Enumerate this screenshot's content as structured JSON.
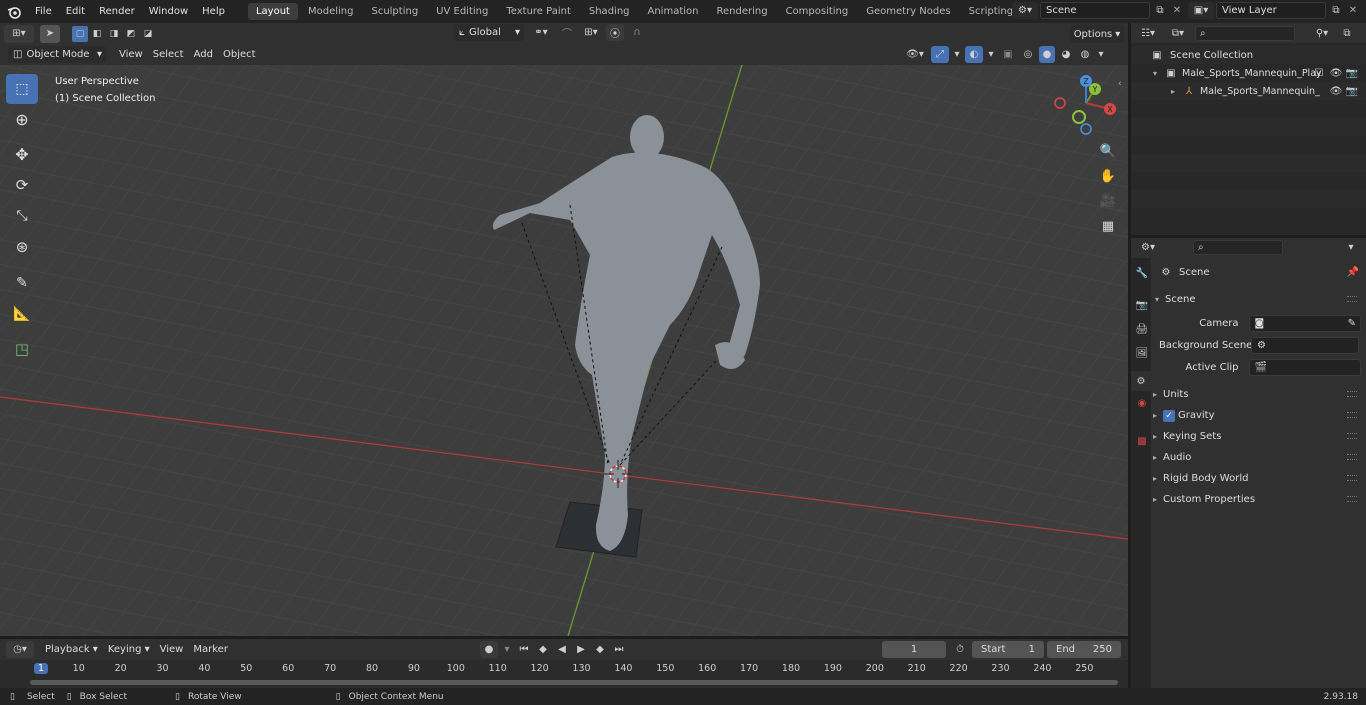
{
  "top_menu": [
    "File",
    "Edit",
    "Render",
    "Window",
    "Help"
  ],
  "workspaces": [
    "Layout",
    "Modeling",
    "Sculpting",
    "UV Editing",
    "Texture Paint",
    "Shading",
    "Animation",
    "Rendering",
    "Compositing",
    "Geometry Nodes",
    "Scripting"
  ],
  "active_workspace": "Layout",
  "scene_field": "Scene",
  "view_layer_field": "View Layer",
  "viewport": {
    "mode": "Object Mode",
    "menus": [
      "View",
      "Select",
      "Add",
      "Object"
    ],
    "transform_orientation": "Global",
    "options_label": "Options",
    "overlay_title": "User Perspective",
    "overlay_subtitle": "(1) Scene Collection",
    "gizmo_axes": {
      "x": "X",
      "y": "Y",
      "z": "Z"
    }
  },
  "outliner": {
    "root": "Scene Collection",
    "items": [
      {
        "label": "Male_Sports_Mannequin_Play"
      },
      {
        "label": "Male_Sports_Mannequin_"
      }
    ]
  },
  "properties": {
    "header": "Scene",
    "section": "Scene",
    "fields": [
      {
        "label": "Camera",
        "icon": "camera-icon"
      },
      {
        "label": "Background Scene",
        "icon": "scene-icon"
      },
      {
        "label": "Active Clip",
        "icon": "clip-icon"
      }
    ],
    "panels": [
      "Units",
      "Gravity",
      "Keying Sets",
      "Audio",
      "Rigid Body World",
      "Custom Properties"
    ],
    "gravity_checked": true
  },
  "timeline": {
    "menus": [
      "Playback",
      "Keying",
      "View",
      "Marker"
    ],
    "current_frame": "1",
    "start_label": "Start",
    "start_value": "1",
    "end_label": "End",
    "end_value": "250",
    "ruler": [
      "1",
      "10",
      "20",
      "30",
      "40",
      "50",
      "60",
      "70",
      "80",
      "90",
      "100",
      "110",
      "120",
      "130",
      "140",
      "150",
      "160",
      "170",
      "180",
      "190",
      "200",
      "210",
      "220",
      "230",
      "240",
      "250"
    ]
  },
  "status": {
    "select": "Select",
    "box_select": "Box Select",
    "rotate_view": "Rotate View",
    "context_menu": "Object Context Menu",
    "version": "2.93.18"
  },
  "colors": {
    "accent": "#4772b3",
    "x_axis": "#b33a3a",
    "y_axis": "#6b9a2a",
    "z_axis": "#3f7dd1"
  }
}
